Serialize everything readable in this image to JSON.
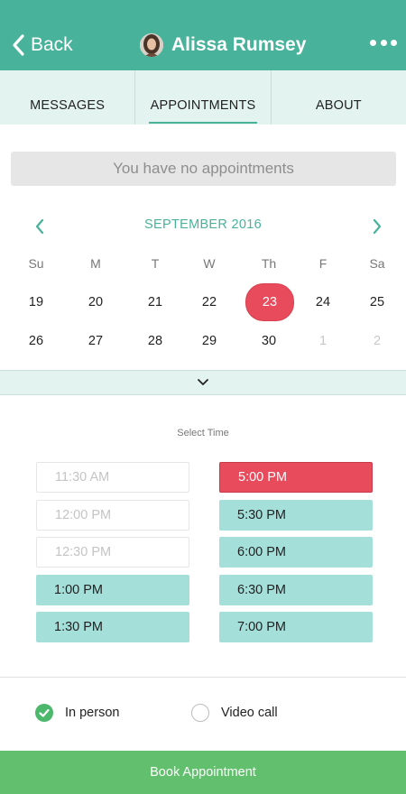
{
  "header": {
    "back_label": "Back",
    "user_name": "Alissa Rumsey",
    "back_icon": "chevron-left-icon",
    "more_icon": "more-horizontal-icon"
  },
  "tabs": [
    {
      "label": "MESSAGES",
      "active": false
    },
    {
      "label": "APPOINTMENTS",
      "active": true
    },
    {
      "label": "ABOUT",
      "active": false
    }
  ],
  "banner": {
    "text": "You have no appointments"
  },
  "calendar": {
    "month_label": "SEPTEMBER 2016",
    "weekdays": [
      "Su",
      "M",
      "T",
      "W",
      "Th",
      "F",
      "Sa"
    ],
    "weeks": [
      [
        "19",
        "20",
        "21",
        "22",
        "23",
        "24",
        "25"
      ],
      [
        "26",
        "27",
        "28",
        "29",
        "30",
        "1",
        "2"
      ]
    ],
    "selected_day": "23",
    "muted_days": [
      "1",
      "2"
    ]
  },
  "time_picker": {
    "label": "Select Time",
    "left_slots": [
      {
        "time": "11:30 AM",
        "state": "unavailable"
      },
      {
        "time": "12:00 PM",
        "state": "unavailable"
      },
      {
        "time": "12:30 PM",
        "state": "unavailable"
      },
      {
        "time": "1:00 PM",
        "state": "available"
      },
      {
        "time": "1:30 PM",
        "state": "available"
      }
    ],
    "right_slots": [
      {
        "time": "5:00 PM",
        "state": "selected"
      },
      {
        "time": "5:30 PM",
        "state": "available"
      },
      {
        "time": "6:00 PM",
        "state": "available"
      },
      {
        "time": "6:30 PM",
        "state": "available"
      },
      {
        "time": "7:00 PM",
        "state": "available"
      }
    ]
  },
  "options": [
    {
      "label": "In person",
      "checked": true
    },
    {
      "label": "Video call",
      "checked": false
    }
  ],
  "book_button": {
    "label": "Book Appointment"
  },
  "colors": {
    "brand": "#48b39a",
    "selected": "#e84b5c",
    "slot_available": "#a4dfda",
    "book": "#62bf6e"
  }
}
